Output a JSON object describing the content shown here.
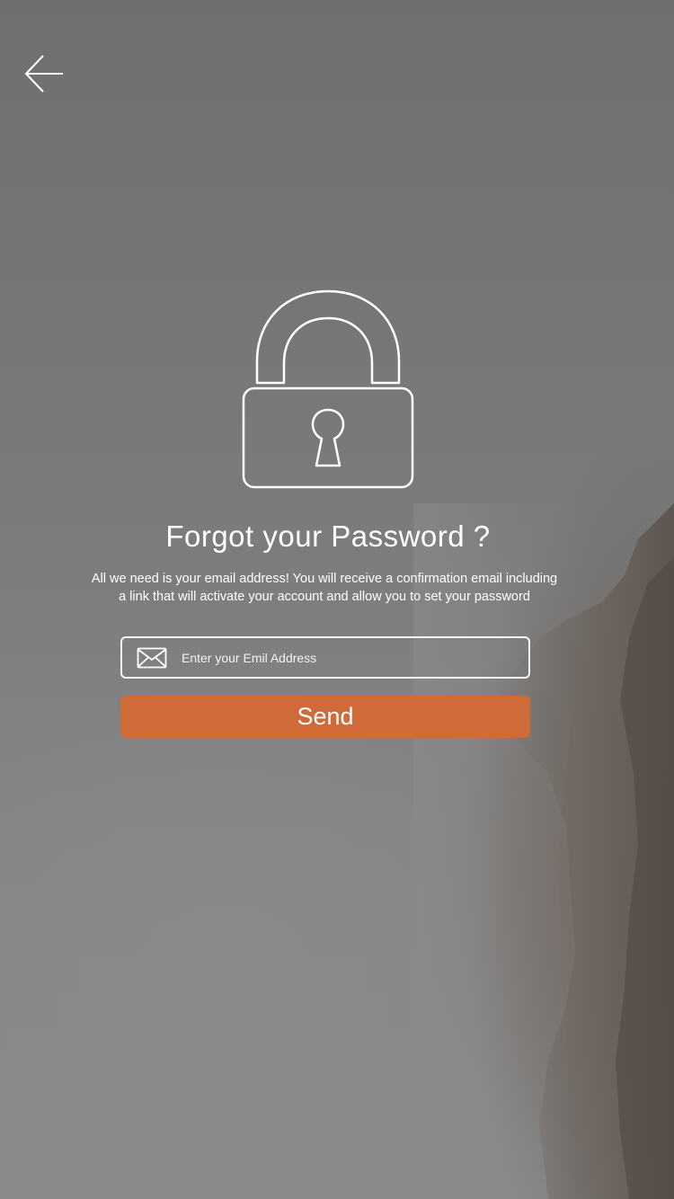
{
  "screen": {
    "title": "Forgot your Password ?",
    "description_line1": "All we need is your email address! You will receive a confirmation email including",
    "description_line2": "a link that will activate your account and allow you to set your password"
  },
  "email_field": {
    "placeholder": "Enter your Emil Address",
    "value": "",
    "icon": "envelope-icon"
  },
  "send_button": {
    "label": "Send",
    "color": "#d06a38"
  },
  "nav": {
    "back_icon": "arrow-left-icon"
  },
  "hero_icon": "padlock-icon"
}
